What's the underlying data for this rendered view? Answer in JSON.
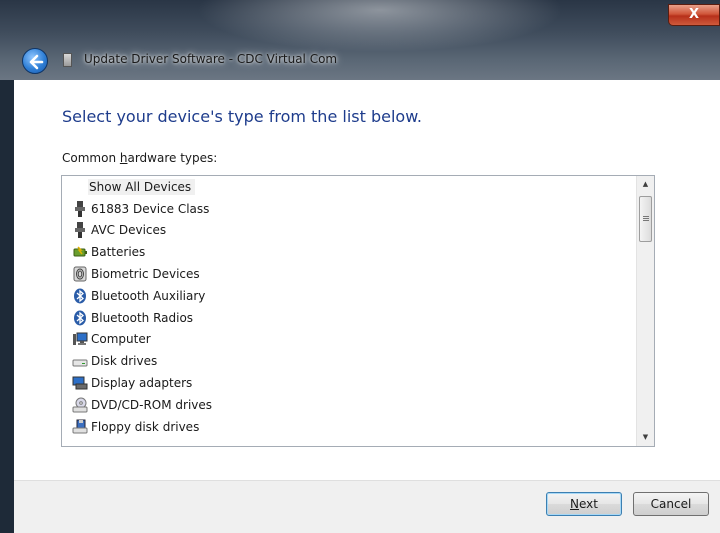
{
  "window": {
    "title": "Update Driver Software - CDC Virtual Com",
    "close_label": "X"
  },
  "main": {
    "heading": "Select your device's type from the list below.",
    "list_label_pre": "Common ",
    "list_label_accel": "h",
    "list_label_post": "ardware types:",
    "items": [
      {
        "label": "Show All Devices",
        "icon": "none"
      },
      {
        "label": "61883 Device Class",
        "icon": "connector-icon"
      },
      {
        "label": "AVC Devices",
        "icon": "connector-icon"
      },
      {
        "label": "Batteries",
        "icon": "battery-icon"
      },
      {
        "label": "Biometric Devices",
        "icon": "fingerprint-icon"
      },
      {
        "label": "Bluetooth Auxiliary",
        "icon": "bluetooth-icon"
      },
      {
        "label": "Bluetooth Radios",
        "icon": "bluetooth-icon"
      },
      {
        "label": "Computer",
        "icon": "computer-icon"
      },
      {
        "label": "Disk drives",
        "icon": "disk-drive-icon"
      },
      {
        "label": "Display adapters",
        "icon": "display-adapter-icon"
      },
      {
        "label": "DVD/CD-ROM drives",
        "icon": "dvd-drive-icon"
      },
      {
        "label": "Floppy disk drives",
        "icon": "floppy-drive-icon"
      }
    ]
  },
  "footer": {
    "next_accel": "N",
    "next_rest": "ext",
    "cancel_label": "Cancel"
  }
}
